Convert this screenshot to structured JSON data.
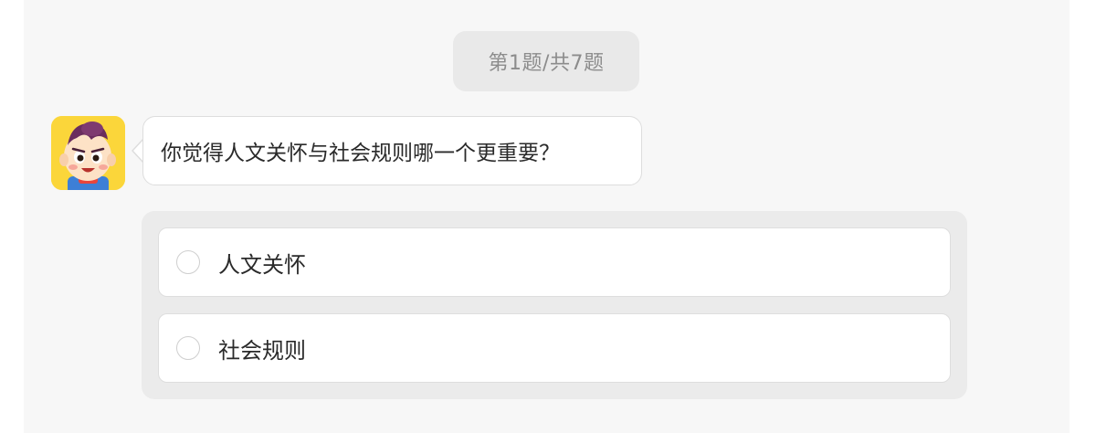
{
  "quiz": {
    "progress_text": "第1题/共7题",
    "question": "你觉得人文关怀与社会规则哪一个更重要？",
    "options": [
      {
        "label": "人文关怀",
        "selected": false
      },
      {
        "label": "社会规则",
        "selected": false
      }
    ]
  },
  "colors": {
    "panel_background": "#f7f7f7",
    "progress_pill_background": "#e9e9e9",
    "options_container_background": "#ebebeb",
    "avatar_background": "#fbd63a"
  }
}
